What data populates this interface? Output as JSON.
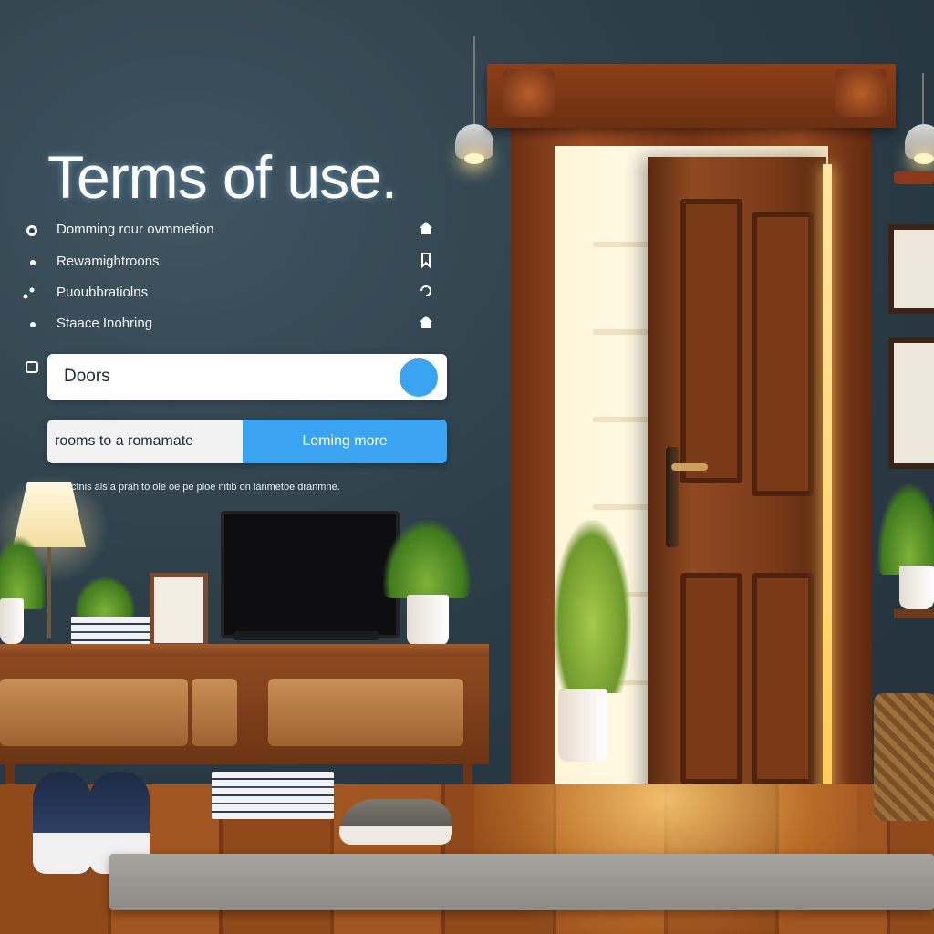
{
  "page": {
    "title": "Terms of use.",
    "menu_items": [
      {
        "label": "Domming rour ovmmetion",
        "icon": "home-icon"
      },
      {
        "label": "Rewamightroons",
        "icon": "bookmark-icon"
      },
      {
        "label": "Puoubbratiolns",
        "icon": "refresh-icon"
      },
      {
        "label": "Staace Inohring",
        "icon": "home-icon"
      }
    ],
    "search": {
      "value": "Doors",
      "placeholder": ""
    },
    "action_row": {
      "left_text": "rooms to a romamate",
      "button_label": "Loming more"
    },
    "footnote": "ctnis als a prah to ole oe pe ploe nitib on lanmetoe dranmne.",
    "colors": {
      "accent": "#3aa3f2",
      "title": "#ffffff"
    }
  }
}
